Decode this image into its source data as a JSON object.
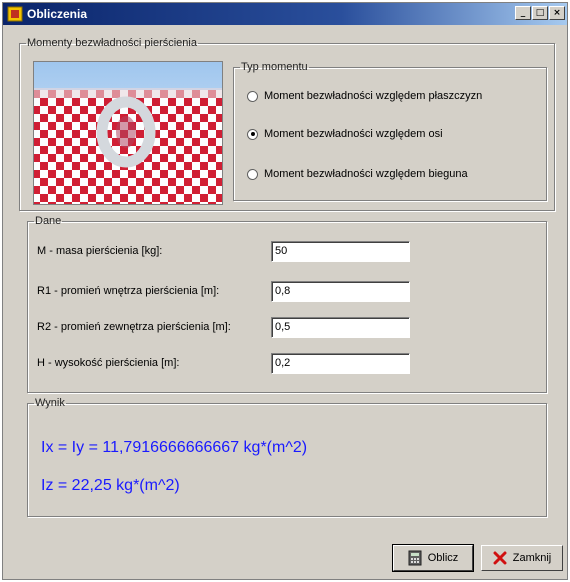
{
  "window": {
    "title": "Obliczenia"
  },
  "title_buttons": {
    "minimize": "_",
    "maximize": "□",
    "close": "×"
  },
  "preview_group": {
    "legend": "Momenty bezwładności pierścienia"
  },
  "moment_type": {
    "legend": "Typ momentu",
    "options": [
      {
        "label": "Moment bezwładności względem płaszczyzn",
        "checked": false
      },
      {
        "label": "Moment bezwładności względem osi",
        "checked": true
      },
      {
        "label": "Moment bezwładności względem bieguna",
        "checked": false
      }
    ]
  },
  "data_group": {
    "legend": "Dane",
    "fields": [
      {
        "label": "M - masa pierścienia [kg]:",
        "value": "50"
      },
      {
        "label": "R1 - promień wnętrza pierścienia [m]:",
        "value": "0,8"
      },
      {
        "label": "R2 - promień zewnętrza pierścienia [m]:",
        "value": "0,5"
      },
      {
        "label": "H - wysokość pierścienia [m]:",
        "value": "0,2"
      }
    ]
  },
  "result_group": {
    "legend": "Wynik",
    "line1": "Ix = Iy = 11,7916666666667 kg*(m^2)",
    "line2": "Iz = 22,25 kg*(m^2)",
    "color": "#1a1aff"
  },
  "buttons": {
    "compute": "Oblicz",
    "close": "Zamknij"
  },
  "colors": {
    "face": "#d4d0c8",
    "title_bar": "#0a246a",
    "checker_red": "#d0142a"
  }
}
